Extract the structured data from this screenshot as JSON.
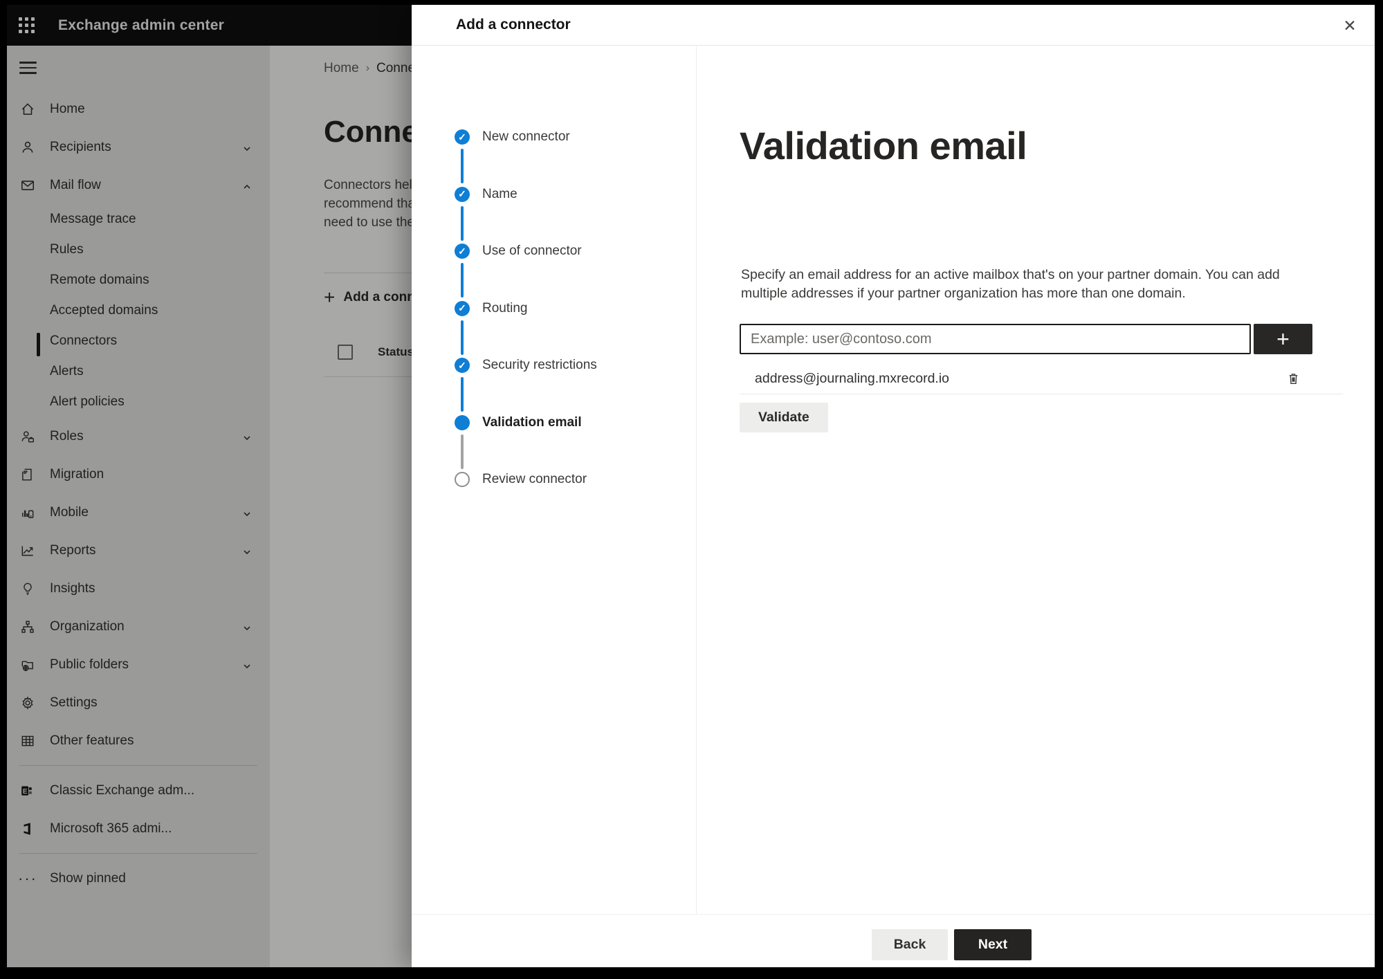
{
  "app": {
    "title": "Exchange admin center"
  },
  "sidebar": {
    "items": [
      {
        "label": "Home"
      },
      {
        "label": "Recipients"
      },
      {
        "label": "Mail flow"
      },
      {
        "label": "Message trace"
      },
      {
        "label": "Rules"
      },
      {
        "label": "Remote domains"
      },
      {
        "label": "Accepted domains"
      },
      {
        "label": "Connectors"
      },
      {
        "label": "Alerts"
      },
      {
        "label": "Alert policies"
      },
      {
        "label": "Roles"
      },
      {
        "label": "Migration"
      },
      {
        "label": "Mobile"
      },
      {
        "label": "Reports"
      },
      {
        "label": "Insights"
      },
      {
        "label": "Organization"
      },
      {
        "label": "Public folders"
      },
      {
        "label": "Settings"
      },
      {
        "label": "Other features"
      },
      {
        "label": "Classic Exchange adm..."
      },
      {
        "label": "Microsoft 365 admi..."
      },
      {
        "label": "Show pinned"
      }
    ]
  },
  "page": {
    "breadcrumb": {
      "home": "Home",
      "separator": "›",
      "current": "Conne"
    },
    "title": "Connec",
    "description_lines": {
      "line1": "Connectors help",
      "line2": "recommend that",
      "line3": "need to use ther"
    },
    "add_button_label": "Add a conn",
    "add_button_plus": "+",
    "table": {
      "status_header": "Status"
    }
  },
  "dialog": {
    "title": "Add a connector",
    "close_glyph": "✕",
    "steps": [
      {
        "label": "New connector",
        "state": "completed"
      },
      {
        "label": "Name",
        "state": "completed"
      },
      {
        "label": "Use of connector",
        "state": "completed"
      },
      {
        "label": "Routing",
        "state": "completed"
      },
      {
        "label": "Security restrictions",
        "state": "completed"
      },
      {
        "label": "Validation email",
        "state": "current"
      },
      {
        "label": "Review connector",
        "state": "upcoming"
      }
    ],
    "content": {
      "heading": "Validation email",
      "description": "Specify an email address for an active mailbox that's on your partner domain. You can add multiple addresses if your partner organization has more than one domain.",
      "email_input": {
        "value": "",
        "placeholder": "Example: user@contoso.com"
      },
      "add_button_glyph": "+",
      "addresses": [
        {
          "email": "address@journaling.mxrecord.io"
        }
      ],
      "validate_button": "Validate"
    },
    "footer": {
      "back": "Back",
      "next": "Next"
    }
  },
  "colors": {
    "accent_blue": "#0f7ed5",
    "topbar": "#0f0f0f",
    "dark_button": "#252423",
    "overlay": "rgba(0,0,0,0.33)"
  }
}
